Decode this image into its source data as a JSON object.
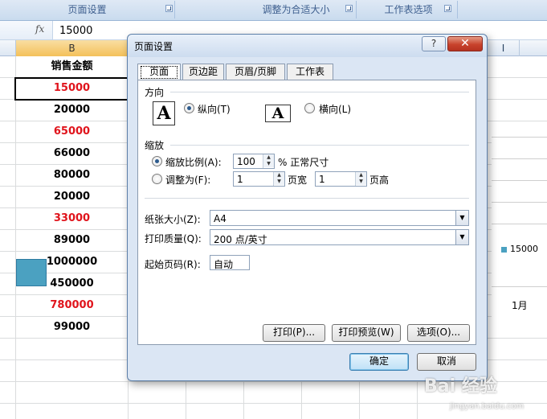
{
  "ribbon": {
    "groups": [
      "页面设置",
      "调整为合适大小",
      "工作表选项"
    ]
  },
  "formula_bar": {
    "fx_icon": "fx",
    "value": "15000"
  },
  "sheet": {
    "columns": [
      "B",
      "I"
    ],
    "header_cell": "销售金额",
    "cells": [
      {
        "value": "15000",
        "color": "#e0141c"
      },
      {
        "value": "20000",
        "color": "#000000"
      },
      {
        "value": "65000",
        "color": "#e0141c"
      },
      {
        "value": "66000",
        "color": "#000000"
      },
      {
        "value": "80000",
        "color": "#000000"
      },
      {
        "value": "20000",
        "color": "#000000"
      },
      {
        "value": "33000",
        "color": "#e0141c"
      },
      {
        "value": "89000",
        "color": "#000000"
      },
      {
        "value": "1000000",
        "color": "#000000"
      },
      {
        "value": "450000",
        "color": "#000000"
      },
      {
        "value": "780000",
        "color": "#e0141c"
      },
      {
        "value": "99000",
        "color": "#000000"
      }
    ]
  },
  "chart": {
    "legend_value": "15000",
    "x_label": "1月",
    "bar_color": "#4ba1c1"
  },
  "dialog": {
    "title": "页面设置",
    "help": "?",
    "close": "✕",
    "tabs": [
      "页面",
      "页边距",
      "页眉/页脚",
      "工作表"
    ],
    "orientation": {
      "title": "方向",
      "portrait_icon": "A",
      "landscape_icon": "A",
      "portrait_label": "纵向(T)",
      "landscape_label": "横向(L)"
    },
    "scaling": {
      "title": "缩放",
      "adjust_label": "缩放比例(A):",
      "adjust_value": "100",
      "adjust_suffix": "% 正常尺寸",
      "fit_label": "调整为(F):",
      "pages_wide_value": "1",
      "pages_wide_label": "页宽",
      "pages_tall_value": "1",
      "pages_tall_label": "页高"
    },
    "paper_size": {
      "label": "纸张大小(Z):",
      "value": "A4"
    },
    "print_quality": {
      "label": "打印质量(Q):",
      "value": "200 点/英寸"
    },
    "first_page": {
      "label": "起始页码(R):",
      "value": "自动"
    },
    "buttons": {
      "print": "打印(P)...",
      "preview": "打印预览(W)",
      "options": "选项(O)...",
      "ok": "确定",
      "cancel": "取消"
    }
  },
  "watermark": {
    "text": "Bai 经验",
    "url": "jingyan.baidu.com"
  }
}
